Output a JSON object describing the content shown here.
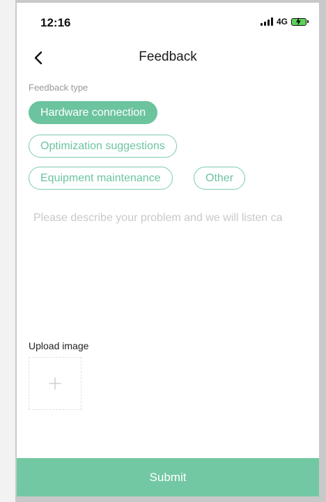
{
  "status_bar": {
    "time": "12:16",
    "network": "4G",
    "icons": [
      "signal-icon",
      "battery-charging-icon"
    ]
  },
  "nav": {
    "back_icon": "chevron-left-icon",
    "title": "Feedback"
  },
  "feedback_type": {
    "label": "Feedback type",
    "options": [
      {
        "label": "Hardware connection",
        "selected": true
      },
      {
        "label": "Optimization suggestions",
        "selected": false
      },
      {
        "label": "Equipment maintenance",
        "selected": false
      },
      {
        "label": "Other",
        "selected": false
      }
    ]
  },
  "description": {
    "value": "",
    "placeholder": "Please describe your problem and we will listen ca"
  },
  "upload": {
    "label": "Upload image",
    "icon": "plus-icon"
  },
  "submit": {
    "label": "Submit"
  },
  "colors": {
    "accent": "#6cc49f",
    "submit_bg": "#72c8a3",
    "placeholder": "#c8c8c8"
  }
}
